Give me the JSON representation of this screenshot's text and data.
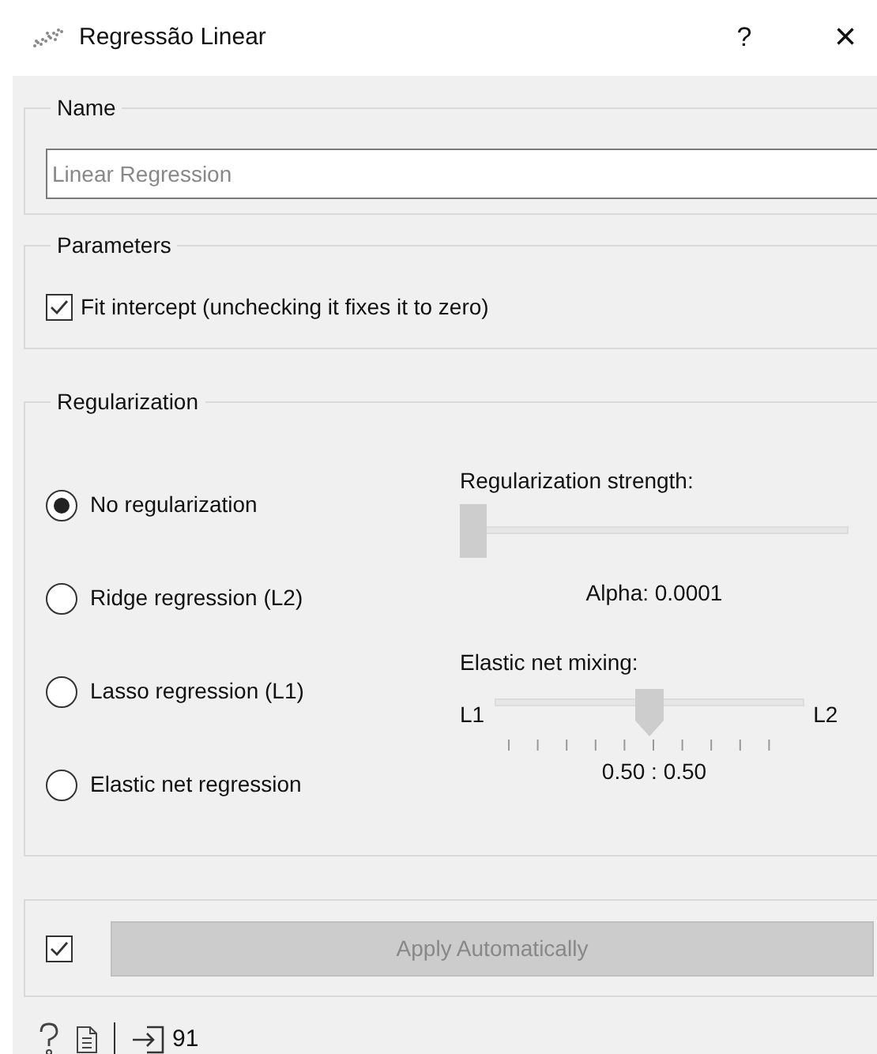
{
  "window": {
    "title": "Regressão Linear",
    "help": "?",
    "close": "×"
  },
  "name_group": {
    "title": "Name",
    "field": {
      "placeholder": "Linear Regression"
    }
  },
  "parameters": {
    "title": "Parameters",
    "fit_intercept": {
      "label": "Fit intercept (unchecking it fixes it to zero)",
      "checked": true
    }
  },
  "regularization": {
    "title": "Regularization",
    "options": [
      {
        "label": "No regularization",
        "selected": true
      },
      {
        "label": "Ridge regression (L2)",
        "selected": false
      },
      {
        "label": "Lasso regression (L1)",
        "selected": false
      },
      {
        "label": "Elastic net regression",
        "selected": false
      }
    ],
    "strength": {
      "label": "Regularization strength:",
      "level": 0,
      "reading": "Alpha: 0.0001"
    },
    "mixing": {
      "label": "Elastic net mixing:",
      "left": "L1",
      "right": "L2",
      "level": 0.5,
      "reading": "0.50 : 0.50"
    }
  },
  "apply": {
    "checked": true,
    "button": "Apply Automatically",
    "disabled": true
  },
  "status_bar": {
    "count": "91"
  }
}
